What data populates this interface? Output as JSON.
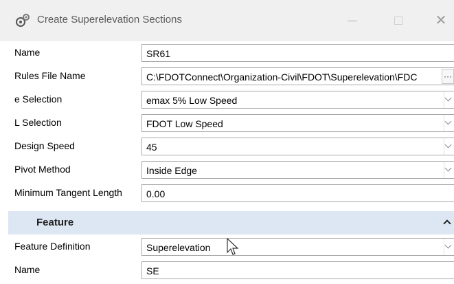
{
  "window": {
    "title": "Create Superelevation Sections",
    "icon": "gears-icon"
  },
  "fields": [
    {
      "label": "Name",
      "value": "SR61",
      "control": "text"
    },
    {
      "label": "Rules File Name",
      "value": "C:\\FDOTConnect\\Organization-Civil\\FDOT\\Superelevation\\FDC",
      "control": "file",
      "button": "···"
    },
    {
      "label": "e Selection",
      "value": "emax 5% Low Speed",
      "control": "dropdown"
    },
    {
      "label": "L Selection",
      "value": "FDOT Low Speed",
      "control": "dropdown"
    },
    {
      "label": "Design Speed",
      "value": "45",
      "control": "dropdown"
    },
    {
      "label": "Pivot Method",
      "value": "Inside Edge",
      "control": "dropdown"
    },
    {
      "label": "Minimum Tangent Length",
      "value": "0.00",
      "control": "text"
    }
  ],
  "feature": {
    "title": "Feature",
    "fields": [
      {
        "label": "Feature Definition",
        "value": "Superelevation",
        "control": "dropdown"
      },
      {
        "label": "Name",
        "value": "SE",
        "control": "text"
      }
    ]
  }
}
